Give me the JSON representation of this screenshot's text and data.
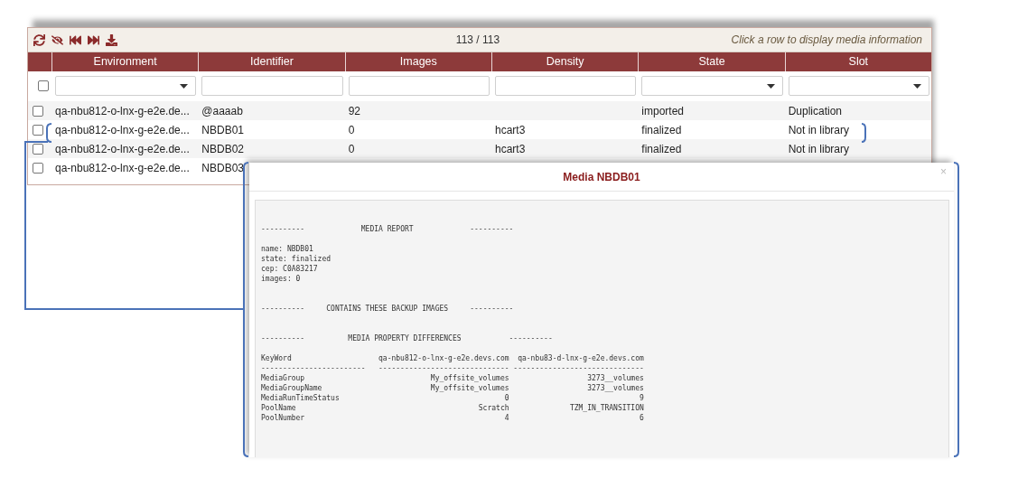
{
  "toolbar": {
    "count": "113 / 113",
    "hint": "Click a row to display media information"
  },
  "table": {
    "columns": [
      "Environment",
      "Identifier",
      "Images",
      "Density",
      "State",
      "Slot"
    ],
    "select_all": {
      "checked": false
    },
    "filters": [
      {
        "kind": "select"
      },
      {
        "kind": "text"
      },
      {
        "kind": "text"
      },
      {
        "kind": "text"
      },
      {
        "kind": "select"
      },
      {
        "kind": "select"
      }
    ],
    "rows": [
      {
        "checked": false,
        "cells": [
          "qa-nbu812-o-lnx-g-e2e.de...",
          "@aaaab",
          "92",
          "",
          "imported",
          "Duplication"
        ]
      },
      {
        "checked": false,
        "cells": [
          "qa-nbu812-o-lnx-g-e2e.de...",
          "NBDB01",
          "0",
          "hcart3",
          "finalized",
          "Not in library"
        ]
      },
      {
        "checked": false,
        "cells": [
          "qa-nbu812-o-lnx-g-e2e.de...",
          "NBDB02",
          "0",
          "hcart3",
          "finalized",
          "Not in library"
        ]
      },
      {
        "checked": false,
        "cells": [
          "qa-nbu812-o-lnx-g-e2e.de...",
          "NBDB03"
        ]
      }
    ]
  },
  "modal": {
    "title": "Media NBDB01",
    "close": "×",
    "sections": [
      {
        "heading": "----------             MEDIA REPORT             ----------",
        "lines": [
          "name: NBDB01",
          "state: finalized",
          "cep: C0A83217",
          "images: 0"
        ]
      },
      {
        "heading": "----------     CONTAINS THESE BACKUP IMAGES     ----------"
      },
      {
        "heading": "----------          MEDIA PROPERTY DIFFERENCES           ----------",
        "table": [
          [
            "KeyWord",
            "qa-nbu812-o-lnx-g-e2e.devs.com",
            "qa-nbu83-d-lnx-g-e2e.devs.com"
          ],
          [
            "------------------------",
            "------------------------------",
            "------------------------------"
          ],
          [
            "MediaGroup",
            "My_offsite_volumes",
            "3273__volumes"
          ],
          [
            "MediaGroupName",
            "My_offsite_volumes",
            "3273__volumes"
          ],
          [
            "MediaRunTimeStatus",
            "0",
            "9"
          ],
          [
            "PoolName",
            "Scratch",
            "TZM_IN_TRANSITION"
          ],
          [
            "PoolNumber",
            "4",
            "6"
          ]
        ]
      }
    ]
  }
}
